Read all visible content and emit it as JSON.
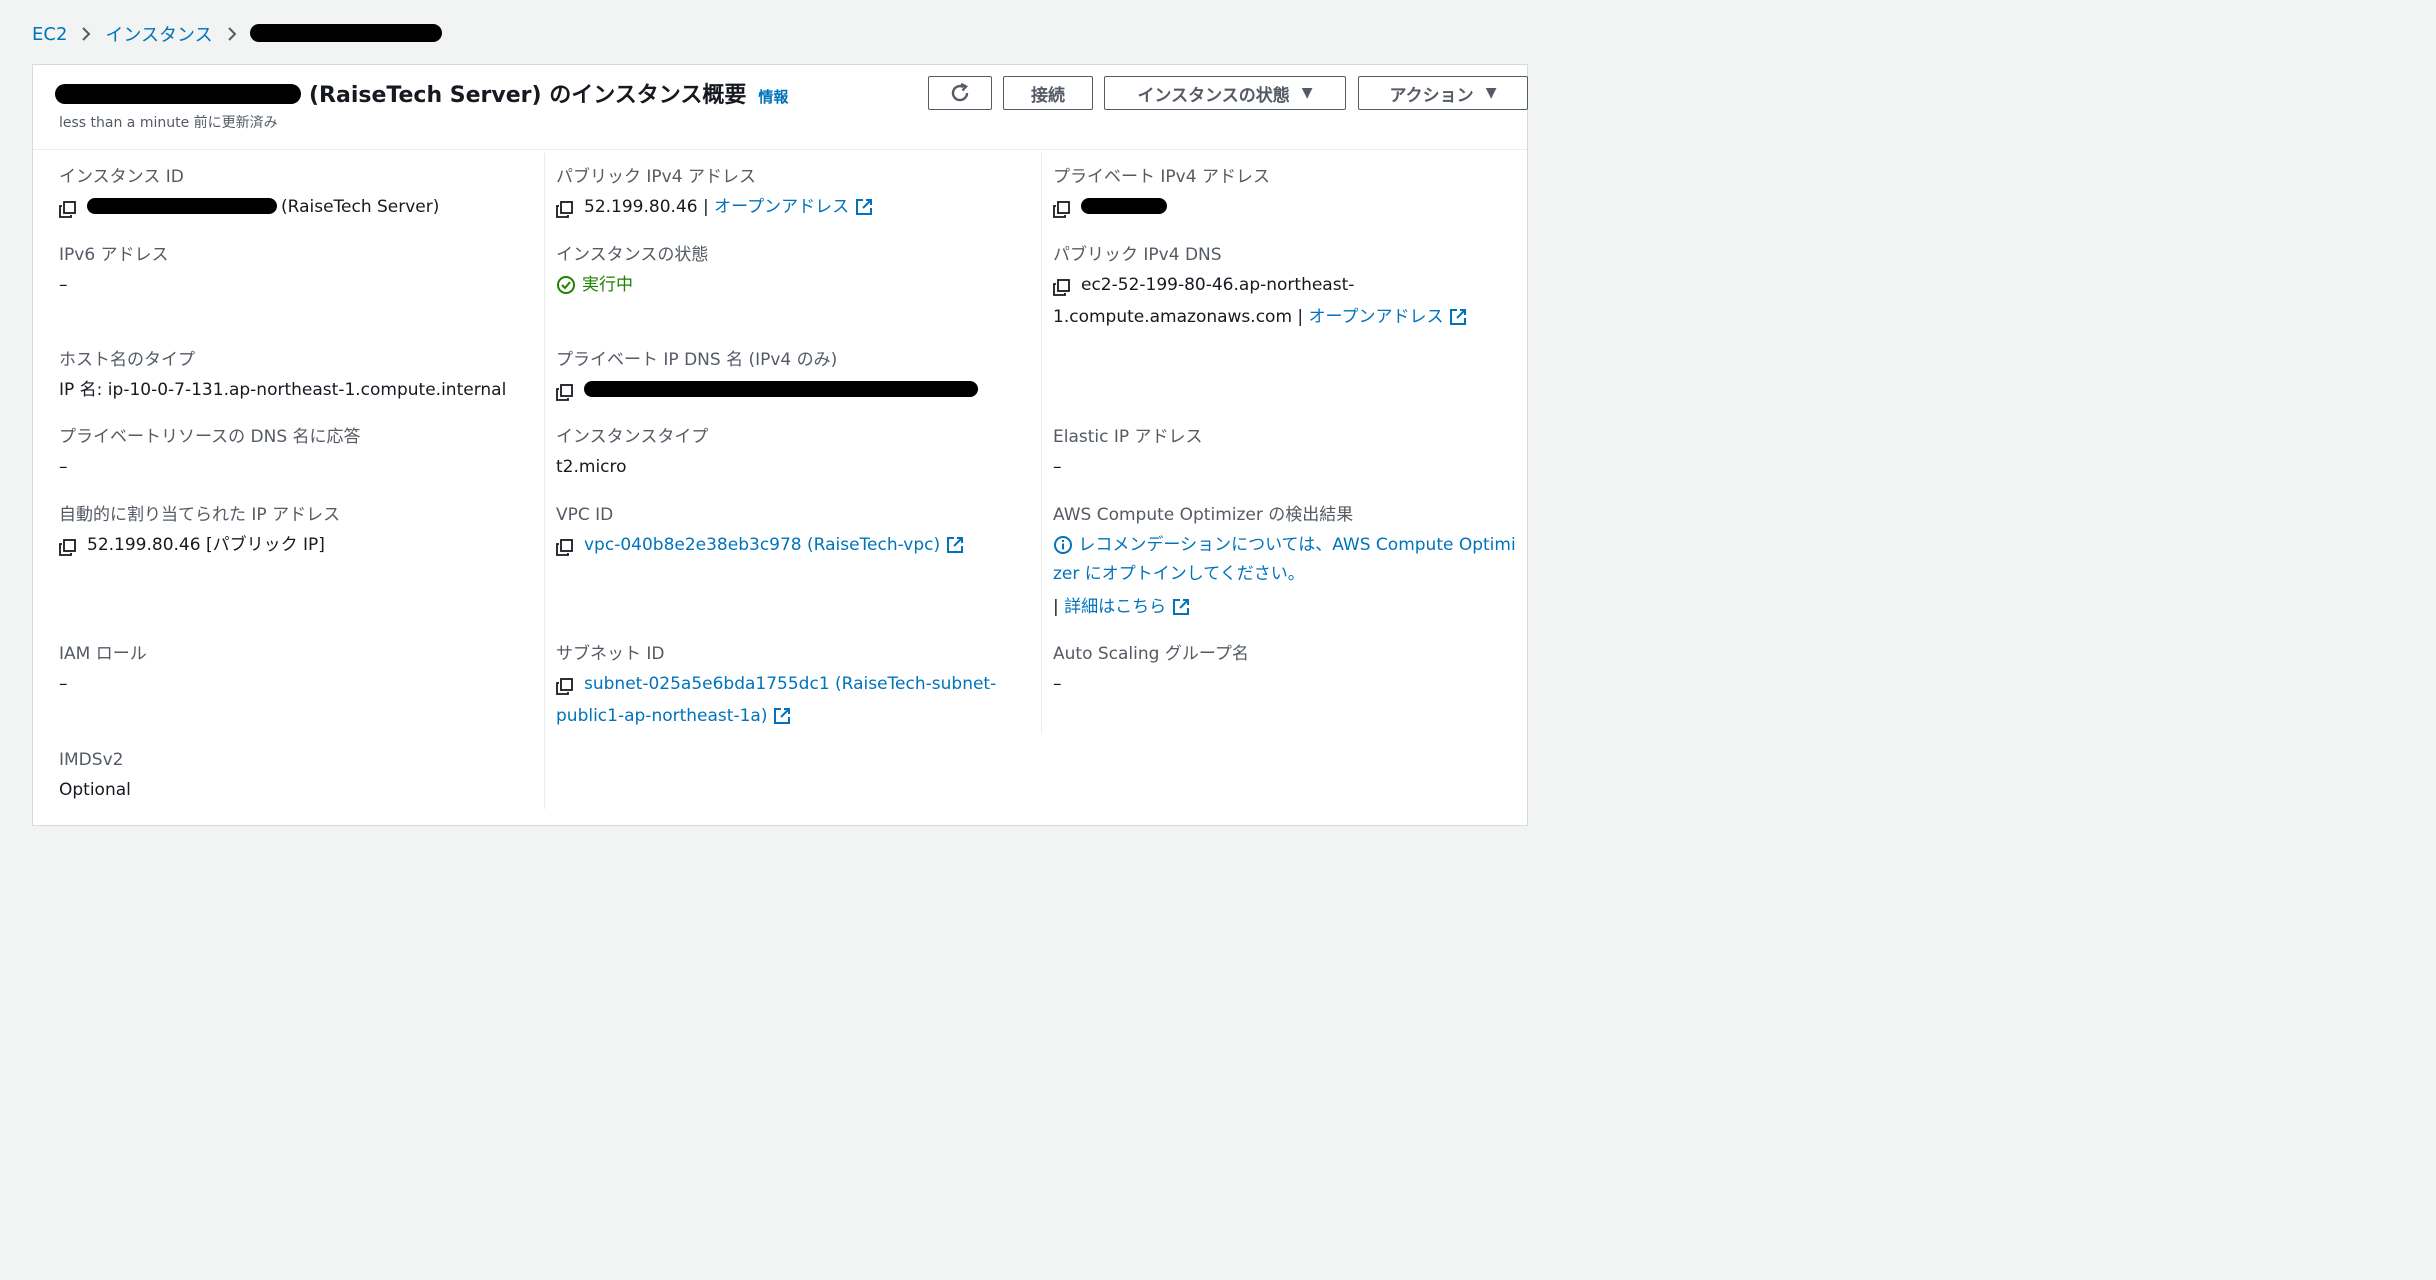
{
  "breadcrumb": {
    "items": [
      "EC2",
      "インスタンス"
    ]
  },
  "header": {
    "title_suffix": "(RaiseTech Server) のインスタンス概要",
    "info_link": "情報",
    "subtitle": "less than a minute 前に更新済み",
    "buttons": {
      "connect": "接続",
      "instance_state": "インスタンスの状態",
      "actions": "アクション"
    }
  },
  "fields": {
    "instance_id": {
      "label": "インスタンス ID",
      "suffix": "(RaiseTech Server)"
    },
    "public_ipv4": {
      "label": "パブリック IPv4 アドレス",
      "value": "52.199.80.46",
      "sep": "|",
      "link": "オープンアドレス"
    },
    "private_ipv4": {
      "label": "プライベート IPv4 アドレス"
    },
    "ipv6": {
      "label": "IPv6 アドレス",
      "value": "–"
    },
    "instance_state": {
      "label": "インスタンスの状態",
      "value": "実行中"
    },
    "public_dns": {
      "label": "パブリック IPv4 DNS",
      "value_line1": "ec2-52-199-80-46.ap-northeast-",
      "value_line2": "1.compute.amazonaws.com",
      "sep": "|",
      "link": "オープンアドレス"
    },
    "hostname_type": {
      "label": "ホスト名のタイプ",
      "value": "IP 名: ip-10-0-7-131.ap-northeast-1.compute.internal"
    },
    "private_dns": {
      "label": "プライベート IP DNS 名 (IPv4 のみ)"
    },
    "private_resource_dns": {
      "label": "プライベートリソースの DNS 名に応答",
      "value": "–"
    },
    "instance_type": {
      "label": "インスタンスタイプ",
      "value": "t2.micro"
    },
    "elastic_ip": {
      "label": "Elastic IP アドレス",
      "value": "–"
    },
    "auto_assigned_ip": {
      "label": "自動的に割り当てられた IP アドレス",
      "value": "52.199.80.46 [パブリック IP]"
    },
    "vpc_id": {
      "label": "VPC ID",
      "value": "vpc-040b8e2e38eb3c978 (RaiseTech-vpc)"
    },
    "optimizer": {
      "label": "AWS Compute Optimizer の検出結果",
      "value_line1": "レコメンデーションについては、AWS Compute Optimi",
      "value_line2": "zer にオプトインしてください。",
      "sep": "|",
      "link": "詳細はこちら"
    },
    "iam_role": {
      "label": "IAM ロール",
      "value": "–"
    },
    "subnet_id": {
      "label": "サブネット ID",
      "value_line1": "subnet-025a5e6bda1755dc1 (RaiseTech-subnet-",
      "value_line2": "public1-ap-northeast-1a)"
    },
    "asg_name": {
      "label": "Auto Scaling グループ名",
      "value": "–"
    },
    "imdsv2": {
      "label": "IMDSv2",
      "value": "Optional"
    }
  },
  "colors": {
    "link": "#0073bb",
    "success": "#1d8102",
    "text": "#16191f",
    "label": "#545b64",
    "background": "#f2f3f3"
  }
}
